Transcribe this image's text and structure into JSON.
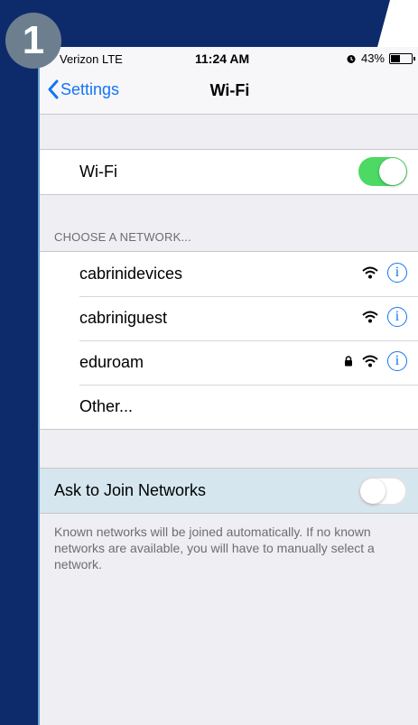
{
  "step_badge": "1",
  "status_bar": {
    "carrier": "Verizon  LTE",
    "time": "11:24 AM",
    "battery": "43%"
  },
  "nav": {
    "back_label": "Settings",
    "title": "Wi-Fi"
  },
  "wifi_toggle": {
    "label": "Wi-Fi",
    "on": true
  },
  "networks_header": "CHOOSE A NETWORK...",
  "networks": [
    {
      "name": "cabrinidevices",
      "secured": false
    },
    {
      "name": "cabriniguest",
      "secured": false
    },
    {
      "name": "eduroam",
      "secured": true
    },
    {
      "name": "Other..."
    }
  ],
  "ask_to_join": {
    "label": "Ask to Join Networks",
    "on": false
  },
  "footer": "Known networks will be joined automatically. If no known networks are available, you will have to manually select a network.",
  "colors": {
    "accent": "#1475f5",
    "toggle_on": "#4cd964",
    "highlight": "#d5e6ee",
    "background": "#0d2b6b"
  }
}
